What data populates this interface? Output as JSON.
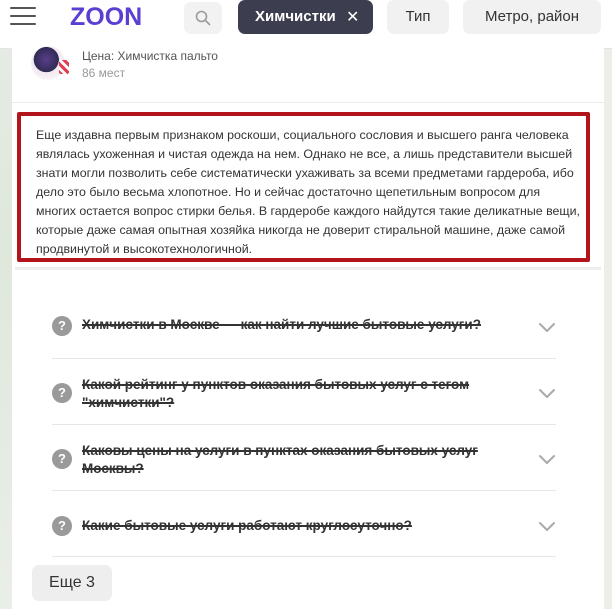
{
  "header": {
    "logo": "ZOON",
    "active_filter": "Химчистки",
    "active_filter_close": "✕",
    "type_filter": "Тип",
    "location_filter": "Метро, район"
  },
  "listing": {
    "price_line": "Цена: Химчистка пальто",
    "places": "86 мест"
  },
  "description": "Еще издавна первым признаком роскоши, социального сословия и высшего ранга человека являлась ухоженная и чистая одежда на нем. Однако не все, а лишь представители высшей знати могли позволить себе систематически ухаживать за всеми предметами гардероба, ибо дело это было весьма хлопотное. Но и сейчас достаточно щепетильным вопросом для многих остается вопрос стирки белья. В гардеробе каждого найдутся такие деликатные вещи, которые даже самая опытная хозяйка никогда не доверит стиральной машине, даже самой продвинутой и высокотехнологичной.",
  "faq": [
    {
      "question": "Химчистки в Москве — как найти лучшие бытовые услуги?"
    },
    {
      "question": "Какой рейтинг у пунктов оказания бытовых услуг с тегом \"химчистки\"?"
    },
    {
      "question": "Каковы цены на услуги в пунктах оказания бытовых услуг Москвы?"
    },
    {
      "question": "Какие бытовые услуги работают круглосуточно?"
    }
  ],
  "faq_icon_glyph": "?",
  "more_button": "Еще 3",
  "colors": {
    "brand": "#5b3fd3",
    "highlight_border": "#b3131b",
    "active_chip": "#3d3d50"
  }
}
